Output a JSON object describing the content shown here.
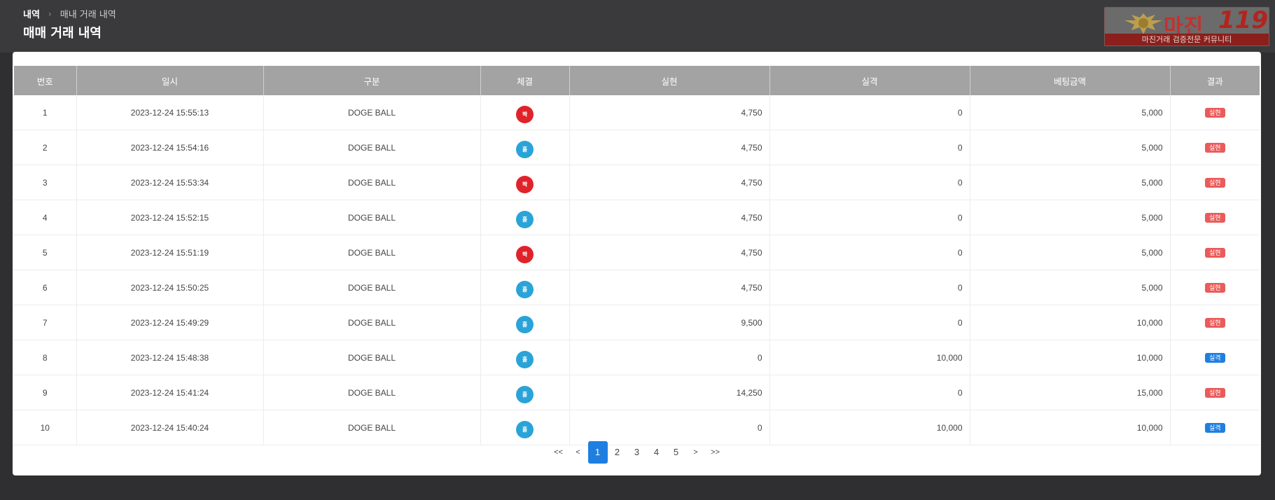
{
  "breadcrumb": {
    "home": "내역",
    "current": "매내 거래 내역"
  },
  "page_title": "매매 거래 내역",
  "logo": {
    "brand": "마진",
    "number": "119",
    "slogan": "마진거래 검증전문 커뮤니티"
  },
  "table": {
    "headers": [
      "번호",
      "일시",
      "구분",
      "체결",
      "실현",
      "실격",
      "베팅금액",
      "결과"
    ],
    "rows": [
      {
        "no": "1",
        "time": "2023-12-24 15:55:13",
        "type": "DOGE BALL",
        "fill": "짝",
        "fill_color": "red",
        "profit": "4,750",
        "loss": "0",
        "bet": "5,000",
        "result": "실현",
        "result_color": "red"
      },
      {
        "no": "2",
        "time": "2023-12-24 15:54:16",
        "type": "DOGE BALL",
        "fill": "홀",
        "fill_color": "blue",
        "profit": "4,750",
        "loss": "0",
        "bet": "5,000",
        "result": "실현",
        "result_color": "red"
      },
      {
        "no": "3",
        "time": "2023-12-24 15:53:34",
        "type": "DOGE BALL",
        "fill": "짝",
        "fill_color": "red",
        "profit": "4,750",
        "loss": "0",
        "bet": "5,000",
        "result": "실현",
        "result_color": "red"
      },
      {
        "no": "4",
        "time": "2023-12-24 15:52:15",
        "type": "DOGE BALL",
        "fill": "홀",
        "fill_color": "blue",
        "profit": "4,750",
        "loss": "0",
        "bet": "5,000",
        "result": "실현",
        "result_color": "red"
      },
      {
        "no": "5",
        "time": "2023-12-24 15:51:19",
        "type": "DOGE BALL",
        "fill": "짝",
        "fill_color": "red",
        "profit": "4,750",
        "loss": "0",
        "bet": "5,000",
        "result": "실현",
        "result_color": "red"
      },
      {
        "no": "6",
        "time": "2023-12-24 15:50:25",
        "type": "DOGE BALL",
        "fill": "홀",
        "fill_color": "blue",
        "profit": "4,750",
        "loss": "0",
        "bet": "5,000",
        "result": "실현",
        "result_color": "red"
      },
      {
        "no": "7",
        "time": "2023-12-24 15:49:29",
        "type": "DOGE BALL",
        "fill": "홀",
        "fill_color": "blue",
        "profit": "9,500",
        "loss": "0",
        "bet": "10,000",
        "result": "실현",
        "result_color": "red"
      },
      {
        "no": "8",
        "time": "2023-12-24 15:48:38",
        "type": "DOGE BALL",
        "fill": "홀",
        "fill_color": "blue",
        "profit": "0",
        "loss": "10,000",
        "bet": "10,000",
        "result": "실격",
        "result_color": "blue"
      },
      {
        "no": "9",
        "time": "2023-12-24 15:41:24",
        "type": "DOGE BALL",
        "fill": "홀",
        "fill_color": "blue",
        "profit": "14,250",
        "loss": "0",
        "bet": "15,000",
        "result": "실현",
        "result_color": "red"
      },
      {
        "no": "10",
        "time": "2023-12-24 15:40:24",
        "type": "DOGE BALL",
        "fill": "홀",
        "fill_color": "blue",
        "profit": "0",
        "loss": "10,000",
        "bet": "10,000",
        "result": "실격",
        "result_color": "blue"
      }
    ]
  },
  "pagination": {
    "first": "<<",
    "prev": "<",
    "pages": [
      "1",
      "2",
      "3",
      "4",
      "5"
    ],
    "current": "1",
    "next": ">",
    "last": ">>"
  },
  "colors": {
    "accent": "#1f7fe0",
    "red": "#e0232a",
    "blue": "#2aa3d8",
    "header_bg": "#a3a3a3"
  }
}
